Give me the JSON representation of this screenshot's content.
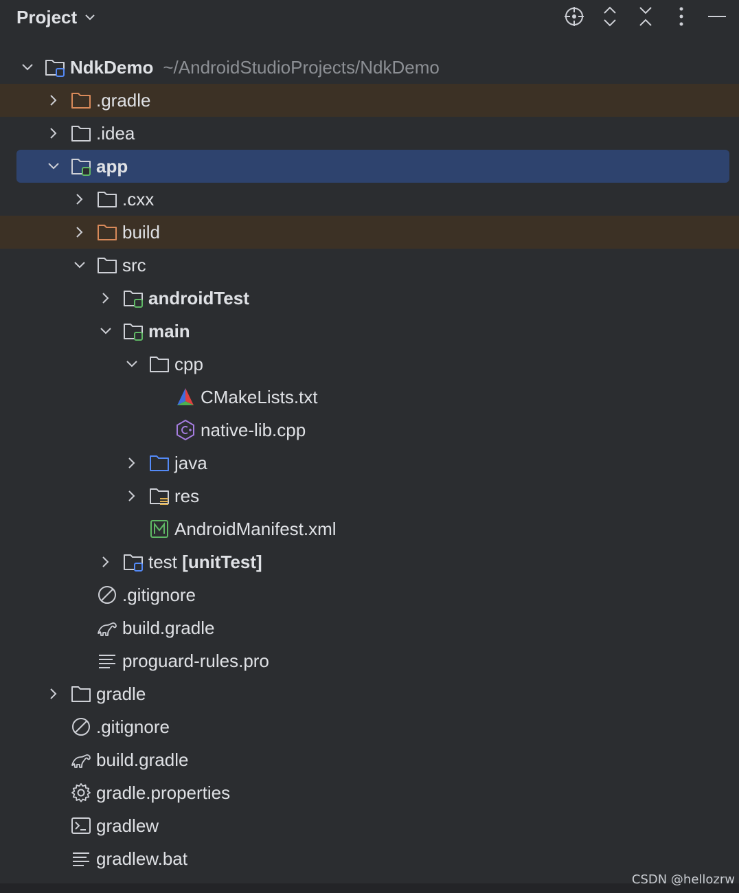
{
  "header": {
    "title": "Project",
    "actions": [
      "locate-icon",
      "expand-all-icon",
      "collapse-all-icon",
      "more-icon",
      "hide-icon"
    ]
  },
  "tree": [
    {
      "label": "NdkDemo",
      "path": "~/AndroidStudioProjects/NdkDemo",
      "depth": 0,
      "chevron": "down",
      "icon": "module-folder",
      "bold": true
    },
    {
      "label": ".gradle",
      "depth": 1,
      "chevron": "right",
      "icon": "excluded-folder",
      "excluded": true
    },
    {
      "label": ".idea",
      "depth": 1,
      "chevron": "right",
      "icon": "folder"
    },
    {
      "label": "app",
      "depth": 1,
      "chevron": "down",
      "icon": "android-module-folder",
      "bold": true,
      "selected": true
    },
    {
      "label": ".cxx",
      "depth": 2,
      "chevron": "right",
      "icon": "folder"
    },
    {
      "label": "build",
      "depth": 2,
      "chevron": "right",
      "icon": "excluded-folder",
      "excluded": true
    },
    {
      "label": "src",
      "depth": 2,
      "chevron": "down",
      "icon": "folder"
    },
    {
      "label": "androidTest",
      "depth": 3,
      "chevron": "right",
      "icon": "android-module-folder",
      "bold": true
    },
    {
      "label": "main",
      "depth": 3,
      "chevron": "down",
      "icon": "android-module-folder",
      "bold": true
    },
    {
      "label": "cpp",
      "depth": 4,
      "chevron": "down",
      "icon": "folder"
    },
    {
      "label": "CMakeLists.txt",
      "depth": 5,
      "chevron": "none",
      "icon": "cmake"
    },
    {
      "label": "native-lib.cpp",
      "depth": 5,
      "chevron": "none",
      "icon": "cpp"
    },
    {
      "label": "java",
      "depth": 4,
      "chevron": "right",
      "icon": "source-folder"
    },
    {
      "label": "res",
      "depth": 4,
      "chevron": "right",
      "icon": "resource-folder"
    },
    {
      "label": "AndroidManifest.xml",
      "depth": 4,
      "chevron": "none",
      "icon": "manifest"
    },
    {
      "label": "test",
      "suffix": "[unitTest]",
      "depth": 3,
      "chevron": "right",
      "icon": "test-module-folder"
    },
    {
      "label": ".gitignore",
      "depth": 2,
      "chevron": "none",
      "icon": "ignore"
    },
    {
      "label": "build.gradle",
      "depth": 2,
      "chevron": "none",
      "icon": "gradle"
    },
    {
      "label": "proguard-rules.pro",
      "depth": 2,
      "chevron": "none",
      "icon": "text"
    },
    {
      "label": "gradle",
      "depth": 1,
      "chevron": "right",
      "icon": "folder"
    },
    {
      "label": ".gitignore",
      "depth": 1,
      "chevron": "none",
      "icon": "ignore"
    },
    {
      "label": "build.gradle",
      "depth": 1,
      "chevron": "none",
      "icon": "gradle"
    },
    {
      "label": "gradle.properties",
      "depth": 1,
      "chevron": "none",
      "icon": "settings"
    },
    {
      "label": "gradlew",
      "depth": 1,
      "chevron": "none",
      "icon": "terminal"
    },
    {
      "label": "gradlew.bat",
      "depth": 1,
      "chevron": "none",
      "icon": "text"
    }
  ],
  "watermark": "CSDN @hellozrw",
  "colors": {
    "background": "#2b2d30",
    "selection": "#2e436e",
    "excluded_row": "#3c3125",
    "excluded_folder": "#d98a5a",
    "module_badge_blue": "#548af7",
    "module_badge_green": "#5fb865",
    "path_text": "#8c8f94"
  }
}
